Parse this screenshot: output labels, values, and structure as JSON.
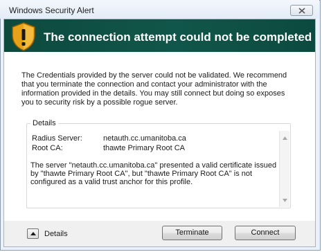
{
  "window": {
    "title": "Windows Security Alert"
  },
  "banner": {
    "icon": "shield-warning-icon",
    "title": "The connection attempt could not be completed"
  },
  "message": "The Credentials provided by the server could not be validated. We recommend that you terminate the connection and contact your administrator with the information provided in the details. You may still connect but doing so exposes you to security risk by a possible rogue server.",
  "details": {
    "legend": "Details",
    "fields": [
      {
        "label": "Radius Server:",
        "value": "netauth.cc.umanitoba.ca"
      },
      {
        "label": "Root CA:",
        "value": "thawte Primary Root CA"
      }
    ],
    "description": "The server \"netauth.cc.umanitoba.ca\" presented a valid certificate issued by \"thawte Primary Root CA\", but \"thawte Primary Root CA\" is not configured as a valid trust anchor for this profile."
  },
  "footer": {
    "details_toggle_label": "Details",
    "terminate_label": "Terminate",
    "connect_label": "Connect"
  },
  "colors": {
    "banner_background": "#11564a",
    "banner_text": "#ffffff",
    "shield_gold": "#e8a21a"
  }
}
